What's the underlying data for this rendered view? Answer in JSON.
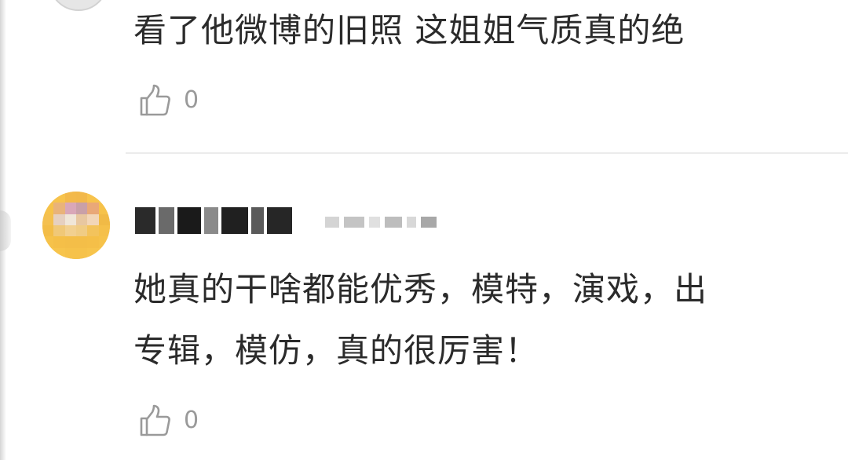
{
  "comments": [
    {
      "text_lines": [
        "看了他微博的旧照 这姐姐气质真的绝"
      ],
      "like_count": "0",
      "like_icon": "thumbs-up-icon"
    },
    {
      "text_lines": [
        "她真的干啥都能优秀，模特，演戏，出",
        "专辑，模仿，真的很厉害！"
      ],
      "like_count": "0",
      "like_icon": "thumbs-up-icon",
      "avatar_color": "#f6c24a"
    }
  ]
}
